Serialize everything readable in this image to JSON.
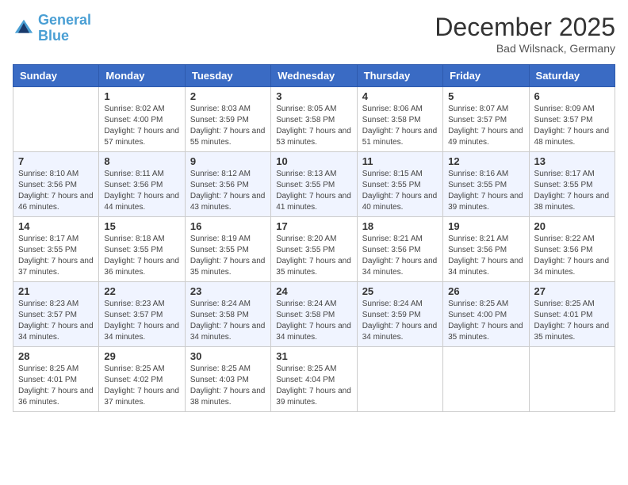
{
  "header": {
    "logo_line1": "General",
    "logo_line2": "Blue",
    "month_title": "December 2025",
    "location": "Bad Wilsnack, Germany"
  },
  "days_of_week": [
    "Sunday",
    "Monday",
    "Tuesday",
    "Wednesday",
    "Thursday",
    "Friday",
    "Saturday"
  ],
  "weeks": [
    [
      {
        "day": "",
        "sunrise": "",
        "sunset": "",
        "daylight": ""
      },
      {
        "day": "1",
        "sunrise": "Sunrise: 8:02 AM",
        "sunset": "Sunset: 4:00 PM",
        "daylight": "Daylight: 7 hours and 57 minutes."
      },
      {
        "day": "2",
        "sunrise": "Sunrise: 8:03 AM",
        "sunset": "Sunset: 3:59 PM",
        "daylight": "Daylight: 7 hours and 55 minutes."
      },
      {
        "day": "3",
        "sunrise": "Sunrise: 8:05 AM",
        "sunset": "Sunset: 3:58 PM",
        "daylight": "Daylight: 7 hours and 53 minutes."
      },
      {
        "day": "4",
        "sunrise": "Sunrise: 8:06 AM",
        "sunset": "Sunset: 3:58 PM",
        "daylight": "Daylight: 7 hours and 51 minutes."
      },
      {
        "day": "5",
        "sunrise": "Sunrise: 8:07 AM",
        "sunset": "Sunset: 3:57 PM",
        "daylight": "Daylight: 7 hours and 49 minutes."
      },
      {
        "day": "6",
        "sunrise": "Sunrise: 8:09 AM",
        "sunset": "Sunset: 3:57 PM",
        "daylight": "Daylight: 7 hours and 48 minutes."
      }
    ],
    [
      {
        "day": "7",
        "sunrise": "Sunrise: 8:10 AM",
        "sunset": "Sunset: 3:56 PM",
        "daylight": "Daylight: 7 hours and 46 minutes."
      },
      {
        "day": "8",
        "sunrise": "Sunrise: 8:11 AM",
        "sunset": "Sunset: 3:56 PM",
        "daylight": "Daylight: 7 hours and 44 minutes."
      },
      {
        "day": "9",
        "sunrise": "Sunrise: 8:12 AM",
        "sunset": "Sunset: 3:56 PM",
        "daylight": "Daylight: 7 hours and 43 minutes."
      },
      {
        "day": "10",
        "sunrise": "Sunrise: 8:13 AM",
        "sunset": "Sunset: 3:55 PM",
        "daylight": "Daylight: 7 hours and 41 minutes."
      },
      {
        "day": "11",
        "sunrise": "Sunrise: 8:15 AM",
        "sunset": "Sunset: 3:55 PM",
        "daylight": "Daylight: 7 hours and 40 minutes."
      },
      {
        "day": "12",
        "sunrise": "Sunrise: 8:16 AM",
        "sunset": "Sunset: 3:55 PM",
        "daylight": "Daylight: 7 hours and 39 minutes."
      },
      {
        "day": "13",
        "sunrise": "Sunrise: 8:17 AM",
        "sunset": "Sunset: 3:55 PM",
        "daylight": "Daylight: 7 hours and 38 minutes."
      }
    ],
    [
      {
        "day": "14",
        "sunrise": "Sunrise: 8:17 AM",
        "sunset": "Sunset: 3:55 PM",
        "daylight": "Daylight: 7 hours and 37 minutes."
      },
      {
        "day": "15",
        "sunrise": "Sunrise: 8:18 AM",
        "sunset": "Sunset: 3:55 PM",
        "daylight": "Daylight: 7 hours and 36 minutes."
      },
      {
        "day": "16",
        "sunrise": "Sunrise: 8:19 AM",
        "sunset": "Sunset: 3:55 PM",
        "daylight": "Daylight: 7 hours and 35 minutes."
      },
      {
        "day": "17",
        "sunrise": "Sunrise: 8:20 AM",
        "sunset": "Sunset: 3:55 PM",
        "daylight": "Daylight: 7 hours and 35 minutes."
      },
      {
        "day": "18",
        "sunrise": "Sunrise: 8:21 AM",
        "sunset": "Sunset: 3:56 PM",
        "daylight": "Daylight: 7 hours and 34 minutes."
      },
      {
        "day": "19",
        "sunrise": "Sunrise: 8:21 AM",
        "sunset": "Sunset: 3:56 PM",
        "daylight": "Daylight: 7 hours and 34 minutes."
      },
      {
        "day": "20",
        "sunrise": "Sunrise: 8:22 AM",
        "sunset": "Sunset: 3:56 PM",
        "daylight": "Daylight: 7 hours and 34 minutes."
      }
    ],
    [
      {
        "day": "21",
        "sunrise": "Sunrise: 8:23 AM",
        "sunset": "Sunset: 3:57 PM",
        "daylight": "Daylight: 7 hours and 34 minutes."
      },
      {
        "day": "22",
        "sunrise": "Sunrise: 8:23 AM",
        "sunset": "Sunset: 3:57 PM",
        "daylight": "Daylight: 7 hours and 34 minutes."
      },
      {
        "day": "23",
        "sunrise": "Sunrise: 8:24 AM",
        "sunset": "Sunset: 3:58 PM",
        "daylight": "Daylight: 7 hours and 34 minutes."
      },
      {
        "day": "24",
        "sunrise": "Sunrise: 8:24 AM",
        "sunset": "Sunset: 3:58 PM",
        "daylight": "Daylight: 7 hours and 34 minutes."
      },
      {
        "day": "25",
        "sunrise": "Sunrise: 8:24 AM",
        "sunset": "Sunset: 3:59 PM",
        "daylight": "Daylight: 7 hours and 34 minutes."
      },
      {
        "day": "26",
        "sunrise": "Sunrise: 8:25 AM",
        "sunset": "Sunset: 4:00 PM",
        "daylight": "Daylight: 7 hours and 35 minutes."
      },
      {
        "day": "27",
        "sunrise": "Sunrise: 8:25 AM",
        "sunset": "Sunset: 4:01 PM",
        "daylight": "Daylight: 7 hours and 35 minutes."
      }
    ],
    [
      {
        "day": "28",
        "sunrise": "Sunrise: 8:25 AM",
        "sunset": "Sunset: 4:01 PM",
        "daylight": "Daylight: 7 hours and 36 minutes."
      },
      {
        "day": "29",
        "sunrise": "Sunrise: 8:25 AM",
        "sunset": "Sunset: 4:02 PM",
        "daylight": "Daylight: 7 hours and 37 minutes."
      },
      {
        "day": "30",
        "sunrise": "Sunrise: 8:25 AM",
        "sunset": "Sunset: 4:03 PM",
        "daylight": "Daylight: 7 hours and 38 minutes."
      },
      {
        "day": "31",
        "sunrise": "Sunrise: 8:25 AM",
        "sunset": "Sunset: 4:04 PM",
        "daylight": "Daylight: 7 hours and 39 minutes."
      },
      {
        "day": "",
        "sunrise": "",
        "sunset": "",
        "daylight": ""
      },
      {
        "day": "",
        "sunrise": "",
        "sunset": "",
        "daylight": ""
      },
      {
        "day": "",
        "sunrise": "",
        "sunset": "",
        "daylight": ""
      }
    ]
  ]
}
